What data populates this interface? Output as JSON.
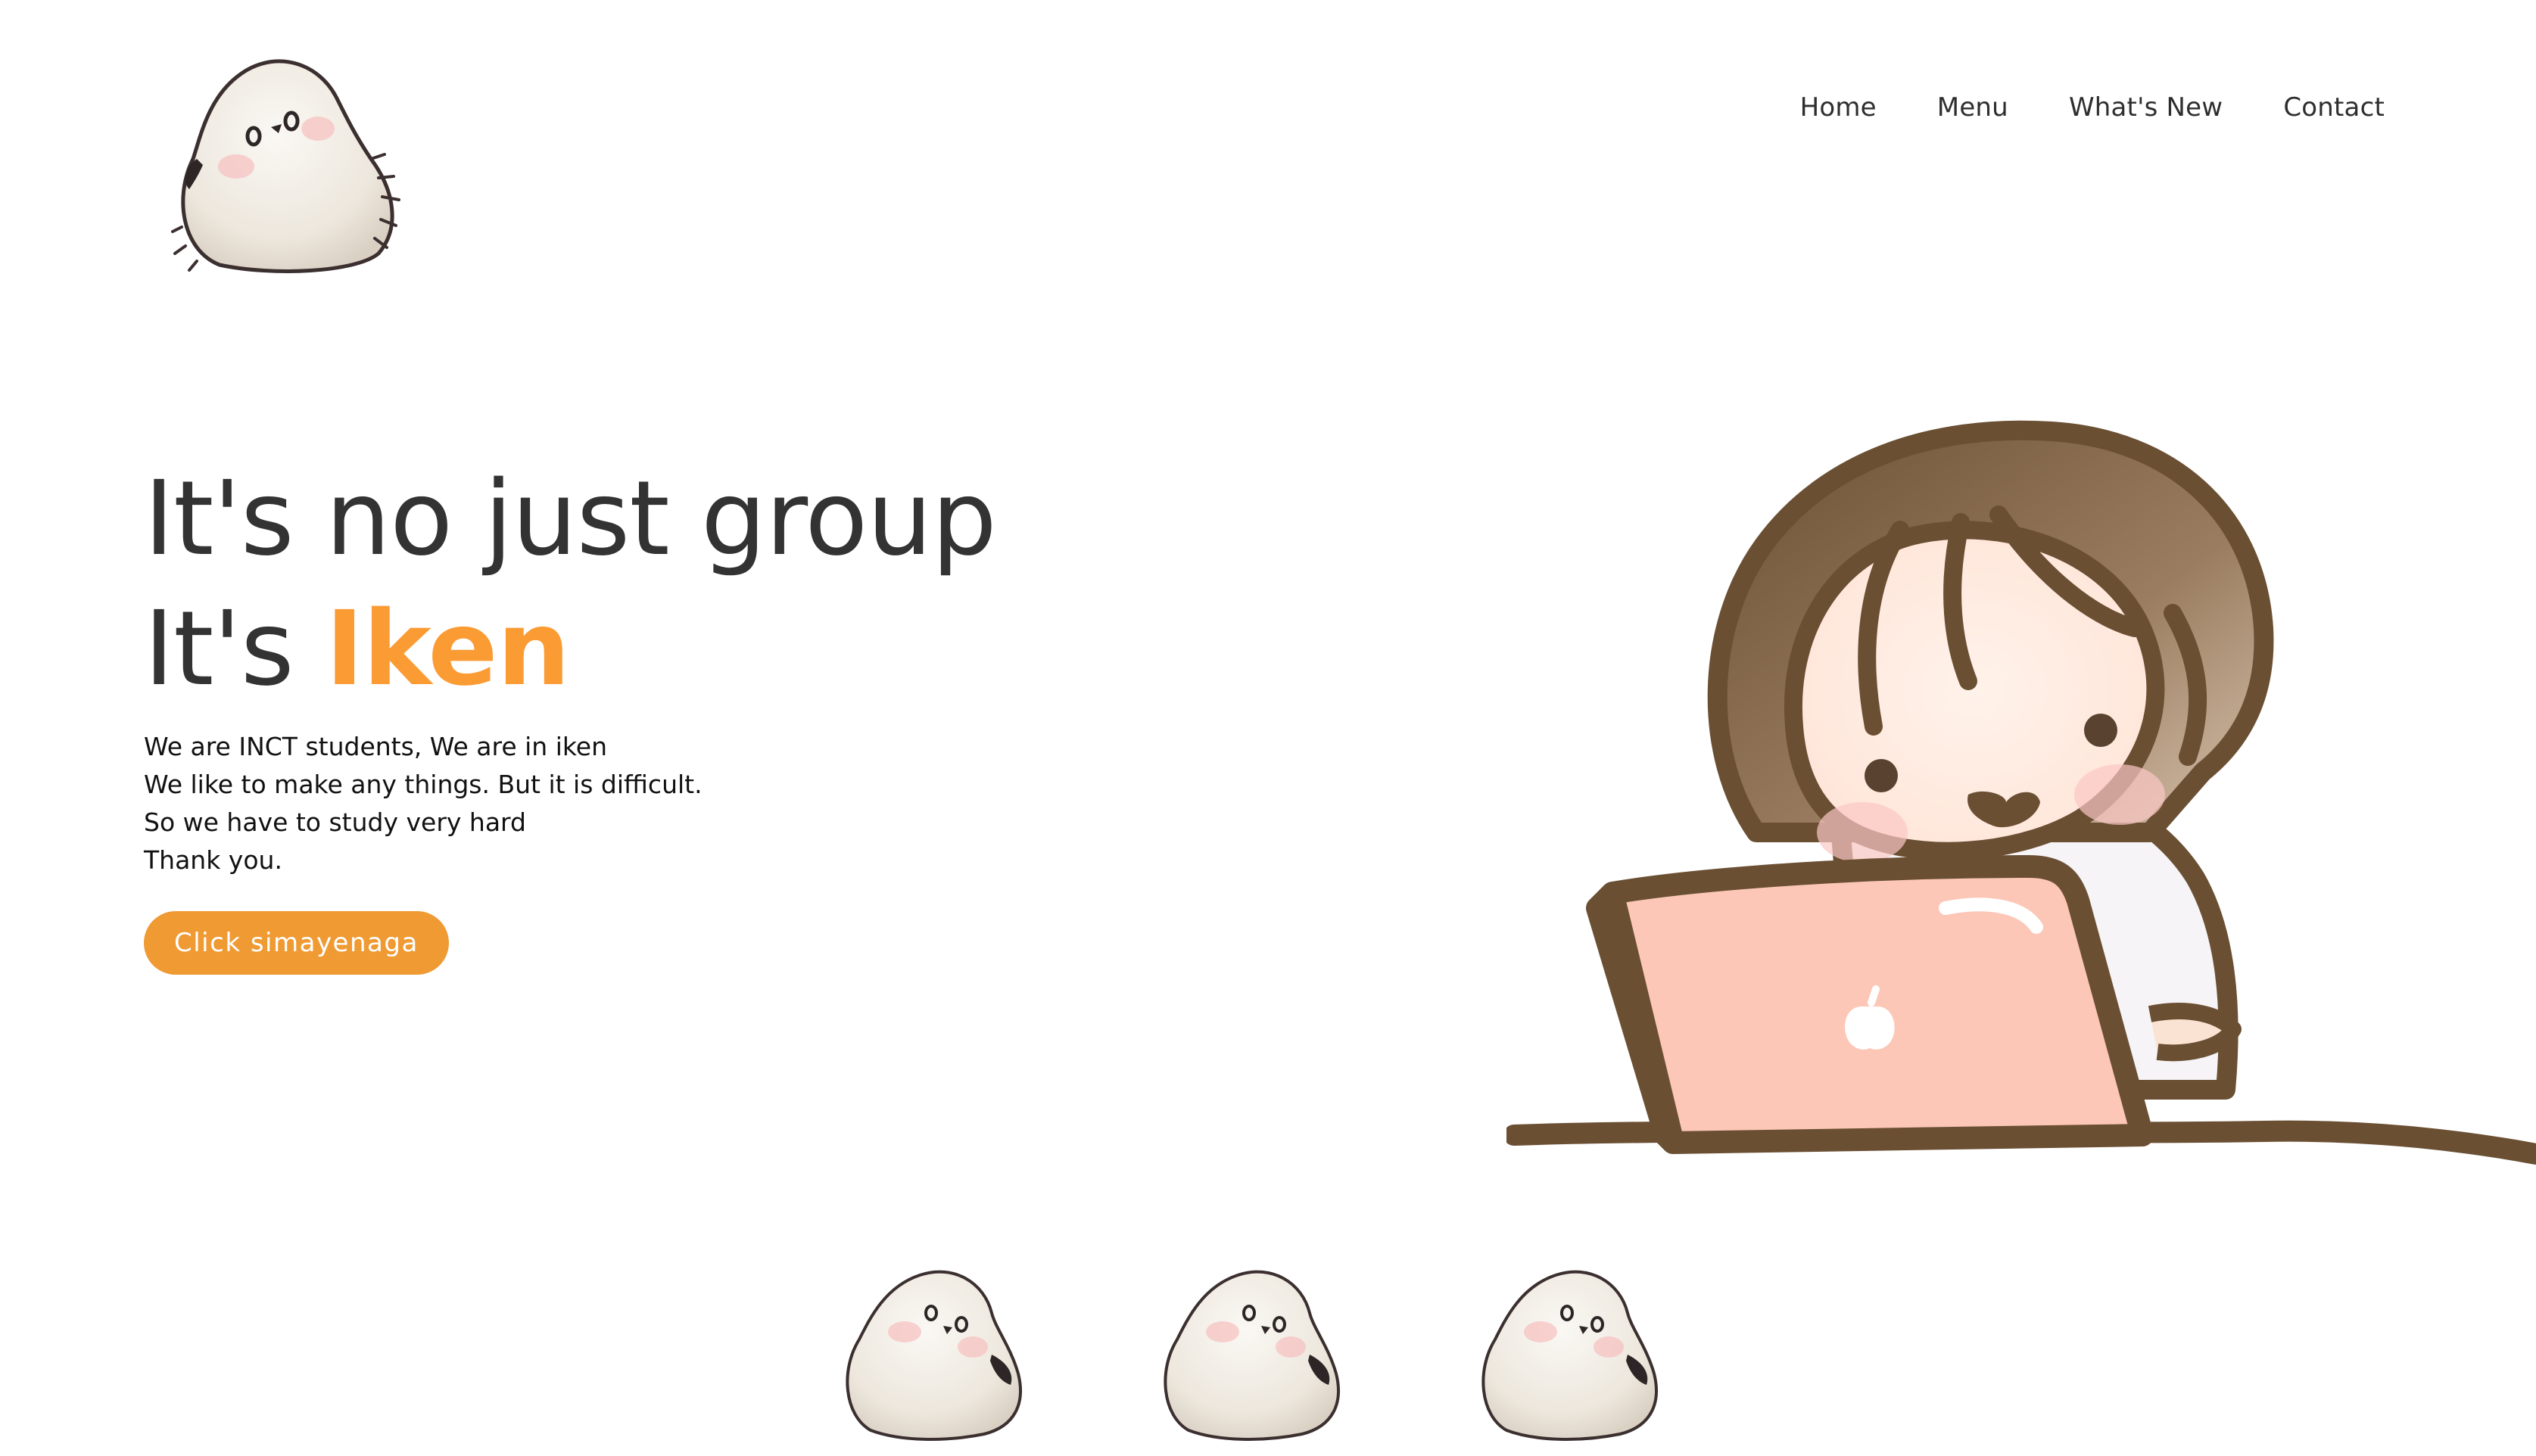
{
  "nav": {
    "items": [
      {
        "label": "Home"
      },
      {
        "label": "Menu"
      },
      {
        "label": "What's New"
      },
      {
        "label": "Contact"
      }
    ]
  },
  "hero": {
    "headline_line1": "It's no just group",
    "headline_line2_prefix": "It's ",
    "headline_brand": "Iken",
    "description": [
      "We are INCT students, We are in iken",
      "We like to make any things. But it is difficult.",
      "So we have to study very hard",
      "Thank you."
    ],
    "cta_label": "Click simayenaga"
  },
  "colors": {
    "accent": "#fb9b34",
    "button": "#ef9a33",
    "text": "#333333",
    "laptop": "#fcc7b7",
    "hair": "#7a5b3a",
    "outline": "#6a4f33",
    "bird_body": "#efeae2"
  },
  "icons": {
    "logo": "shimaenaga-bird-logo",
    "illustration": "girl-with-laptop-illustration",
    "footer_birds": [
      "shimaenaga-bird",
      "shimaenaga-bird",
      "shimaenaga-bird"
    ]
  }
}
